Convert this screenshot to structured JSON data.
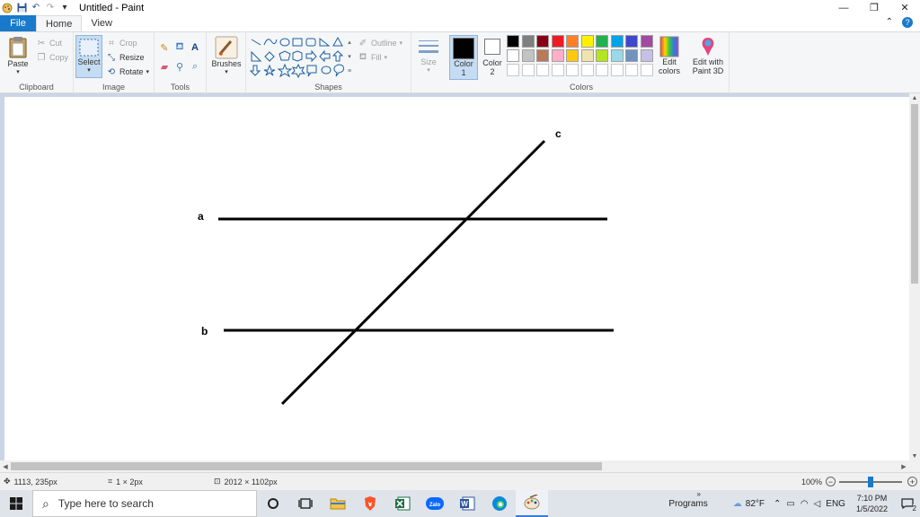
{
  "window": {
    "title": "Untitled - Paint",
    "controls": {
      "minimize": "—",
      "restore": "❐",
      "close": "✕"
    }
  },
  "tabs": [
    {
      "label": "File"
    },
    {
      "label": "Home"
    },
    {
      "label": "View"
    }
  ],
  "ribbon": {
    "clipboard": {
      "label": "Clipboard",
      "paste": "Paste",
      "cut": "Cut",
      "copy": "Copy"
    },
    "image": {
      "label": "Image",
      "select": "Select",
      "crop": "Crop",
      "resize": "Resize",
      "rotate": "Rotate"
    },
    "tools": {
      "label": "Tools"
    },
    "brushes": {
      "label": "Brushes"
    },
    "shapes": {
      "label": "Shapes",
      "outline": "Outline",
      "fill": "Fill"
    },
    "size": {
      "label": "Size"
    },
    "color1": {
      "label": "Color",
      "sub": "1"
    },
    "color2": {
      "label": "Color",
      "sub": "2"
    },
    "colors": {
      "label": "Colors",
      "row1": [
        "#000000",
        "#7f7f7f",
        "#880015",
        "#ed1c24",
        "#ff7f27",
        "#fff200",
        "#22b14c",
        "#00a2e8",
        "#3f48cc",
        "#a349a4"
      ],
      "row2": [
        "#ffffff",
        "#c3c3c3",
        "#b97a57",
        "#ffaec9",
        "#ffc90e",
        "#efe4b0",
        "#b5e61d",
        "#99d9ea",
        "#7092be",
        "#c8bfe7"
      ],
      "row3": [
        "#ffffff",
        "#ffffff",
        "#ffffff",
        "#ffffff",
        "#ffffff",
        "#ffffff",
        "#ffffff",
        "#ffffff",
        "#ffffff",
        "#ffffff"
      ]
    },
    "edit_colors": {
      "line1": "Edit",
      "line2": "colors"
    },
    "paint3d": {
      "line1": "Edit with",
      "line2": "Paint 3D"
    }
  },
  "drawing": {
    "labels": {
      "a": "a",
      "b": "b",
      "c": "c"
    }
  },
  "status": {
    "cursor_pos": "1113, 235px",
    "selection_size": "1 × 2px",
    "image_size": "2012 × 1102px",
    "zoom": "100%",
    "zoom_level": 0.5
  },
  "taskbar": {
    "search_placeholder": "Type here to search",
    "programs": "Programs",
    "weather": "82°F",
    "language": "ENG",
    "time": "7:10 PM",
    "date": "1/5/2022",
    "notif_count": "2"
  }
}
